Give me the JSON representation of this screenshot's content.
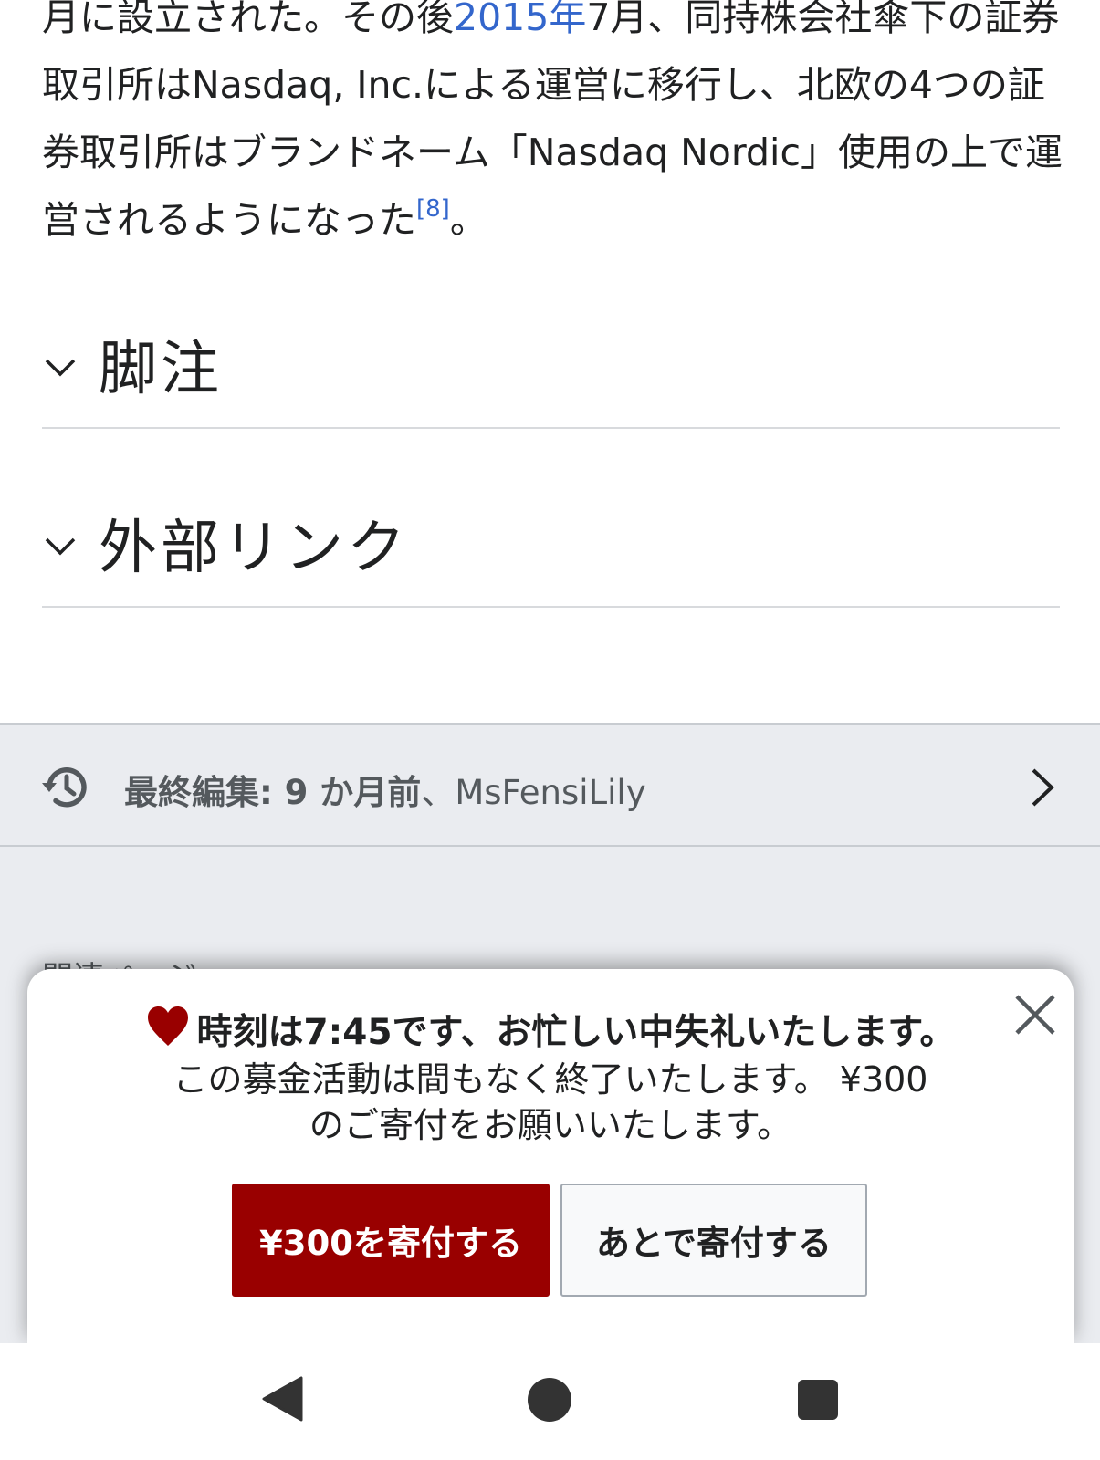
{
  "article": {
    "p_part1": "月に設立された。その後",
    "p_link_2015": "2015年",
    "p_part2": "7月、同持株会社傘下の証券取引所はNasdaq, Inc.による運営に移行し、北欧の4つの証券取引所はブランドネーム「Nasdaq Nordic」使用の上で運営されるようになった",
    "p_ref": "[8]",
    "p_end": "。"
  },
  "sections": [
    {
      "title": "脚注"
    },
    {
      "title": "外部リンク"
    }
  ],
  "last_edited": {
    "label": "最終編集: 9 か月前",
    "separator": "、",
    "user": "MsFensiLily"
  },
  "related_peek": "関連ページ",
  "banner": {
    "headline": "時刻は7:45です、お忙しい中失礼いたします。",
    "body_line1": "この募金活動は間もなく終了いたします。 ¥300",
    "body_line2": "のご寄付をお願いいたします。",
    "donate_button": "¥300を寄付する",
    "later_button": "あとで寄付する"
  },
  "colors": {
    "link": "#3366cc",
    "donate_bg": "#990000",
    "heart": "#990000",
    "footer_bg": "#eaecf0"
  }
}
